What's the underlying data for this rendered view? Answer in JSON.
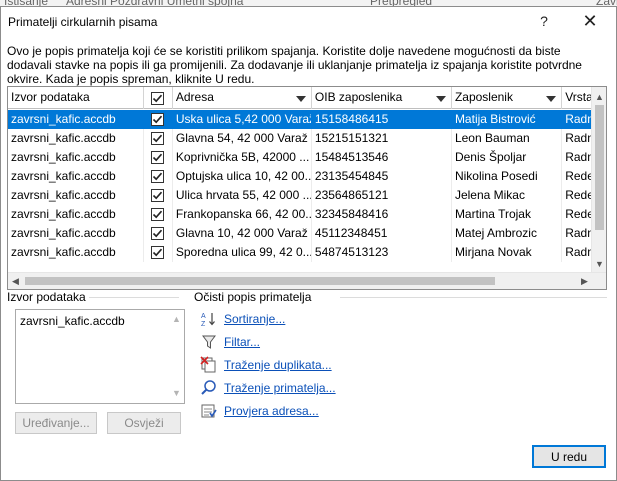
{
  "backdrop": {
    "fragments": [
      "Istisanje",
      "Adresni  Pozdravni  Umetni spojna",
      "Pretpregled",
      "Zavr"
    ]
  },
  "dialog": {
    "title": "Primatelji cirkularnih pisama",
    "help_glyph": "?",
    "close_glyph": "✕",
    "description": "Ovo je popis primatelja koji će se koristiti prilikom spajanja. Koristite dolje navedene mogućnosti da biste dodavali stavke na popis ili ga promijenili. Za dodavanje ili uklanjanje primatelja iz spajanja koristite potvrdne okvire. Kada je popis spreman, kliknite U redu."
  },
  "grid": {
    "headers": [
      "Izvor podataka",
      "",
      "Adresa",
      "OIB zaposlenika",
      "Zaposlenik",
      "Vrsta"
    ],
    "rows": [
      {
        "source": "zavrsni_kafic.accdb",
        "checked": true,
        "address": "Uska ulica 5,42 000 Varaž...",
        "oib": "15158486415",
        "employee": "Matija Bistrović",
        "type": "Radn",
        "selected": true
      },
      {
        "source": "zavrsni_kafic.accdb",
        "checked": true,
        "address": "Glavna 54, 42 000 Varaž",
        "oib": "15215151321",
        "employee": "Leon Bauman",
        "type": "Radn",
        "selected": false
      },
      {
        "source": "zavrsni_kafic.accdb",
        "checked": true,
        "address": "Koprivnička 5B, 42000 ...",
        "oib": "15484513546",
        "employee": "Denis Špoljar",
        "type": "Radn",
        "selected": false
      },
      {
        "source": "zavrsni_kafic.accdb",
        "checked": true,
        "address": "Optujska ulica 10, 42 00...",
        "oib": "23135454845",
        "employee": "Nikolina Posedi",
        "type": "Rede",
        "selected": false
      },
      {
        "source": "zavrsni_kafic.accdb",
        "checked": true,
        "address": "Ulica hrvata 55, 42 000 ...",
        "oib": "23564865121",
        "employee": "Jelena Mikac",
        "type": "Rede",
        "selected": false
      },
      {
        "source": "zavrsni_kafic.accdb",
        "checked": true,
        "address": "Frankopanska 66, 42 00...",
        "oib": "32345848416",
        "employee": "Martina Trojak",
        "type": "Rede",
        "selected": false
      },
      {
        "source": "zavrsni_kafic.accdb",
        "checked": true,
        "address": "Glavna 10, 42 000 Varaž",
        "oib": "45112348451",
        "employee": "Matej Ambrozic",
        "type": "Radn",
        "selected": false
      },
      {
        "source": "zavrsni_kafic.accdb",
        "checked": true,
        "address": "Sporedna ulica 99, 42 0...",
        "oib": "54874513123",
        "employee": "Mirjana Novak",
        "type": "Radn",
        "selected": false
      }
    ]
  },
  "source_panel": {
    "label": "Izvor podataka",
    "items": [
      "zavrsni_kafic.accdb"
    ],
    "edit_button": "Uređivanje...",
    "refresh_button": "Osvježi"
  },
  "refine_panel": {
    "label": "Očisti popis primatelja",
    "links": [
      "Sortiranje...",
      "Filtar...",
      "Traženje duplikata...",
      "Traženje primatelja...",
      "Provjera adresa..."
    ]
  },
  "ok_button": "U redu"
}
